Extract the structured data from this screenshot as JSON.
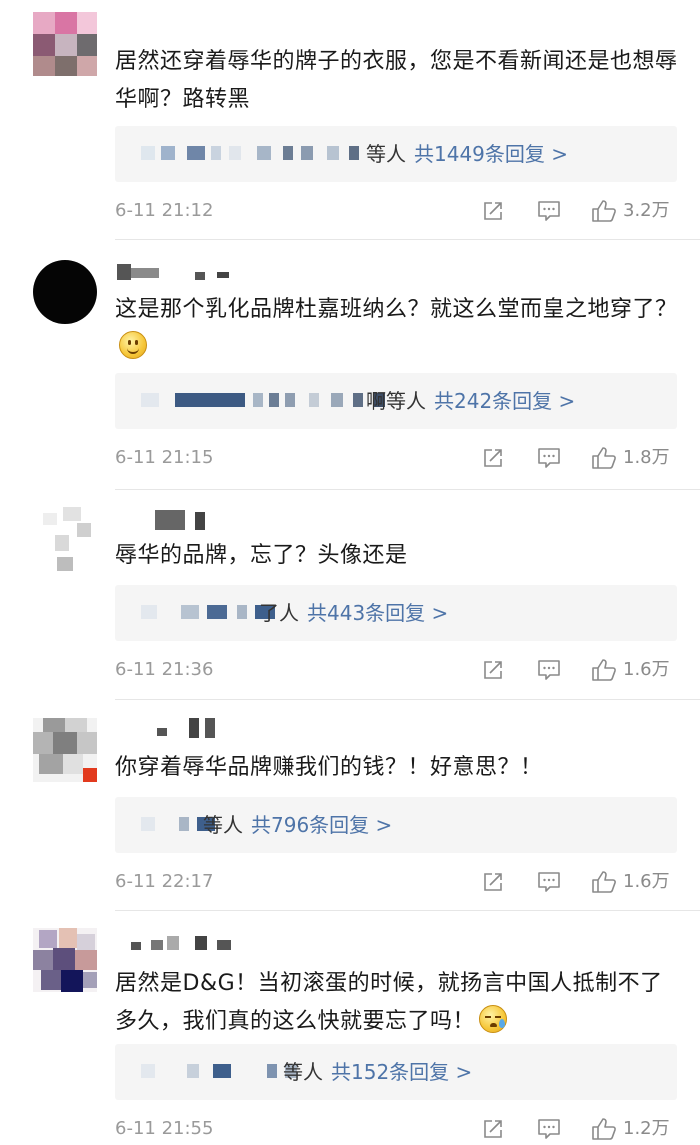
{
  "comments": [
    {
      "content": "居然还穿着辱华的牌子的衣服，您是不看新闻还是也想辱华啊？路转黑",
      "emoji": "",
      "names_suffix": "等人",
      "replies_link": "共1449条回复 >",
      "timestamp": "6-11 21:12",
      "likes": "3.2万"
    },
    {
      "content": "这是那个乳化品牌杜嘉班纳么？就这么堂而皇之地穿了？",
      "emoji": "smile-emoji",
      "names_suffix": "啊等人",
      "replies_link": "共242条回复 >",
      "timestamp": "6-11 21:15",
      "likes": "1.8万"
    },
    {
      "content": "辱华的品牌，忘了？头像还是",
      "emoji": "",
      "names_suffix": "了人",
      "replies_link": "共443条回复 >",
      "timestamp": "6-11 21:36",
      "likes": "1.6万"
    },
    {
      "content": "你穿着辱华品牌赚我们的钱？！好意思？！",
      "emoji": "",
      "names_suffix": "等人",
      "replies_link": "共796条回复 >",
      "timestamp": "6-11 22:17",
      "likes": "1.6万"
    },
    {
      "content": "居然是D&G！当初滚蛋的时候，就扬言中国人抵制不了多久，我们真的这么快就要忘了吗！",
      "emoji": "sweat-emoji",
      "names_suffix": "等人",
      "replies_link": "共152条回复 >",
      "timestamp": "6-11 21:55",
      "likes": "1.2万"
    }
  ],
  "icons": {
    "repost": "share-icon",
    "comment": "comment-icon",
    "like": "thumbs-up-icon"
  },
  "colors": {
    "link": "#4e74a8",
    "meta": "#9a9a9a",
    "reply_box": "#f5f5f5"
  }
}
